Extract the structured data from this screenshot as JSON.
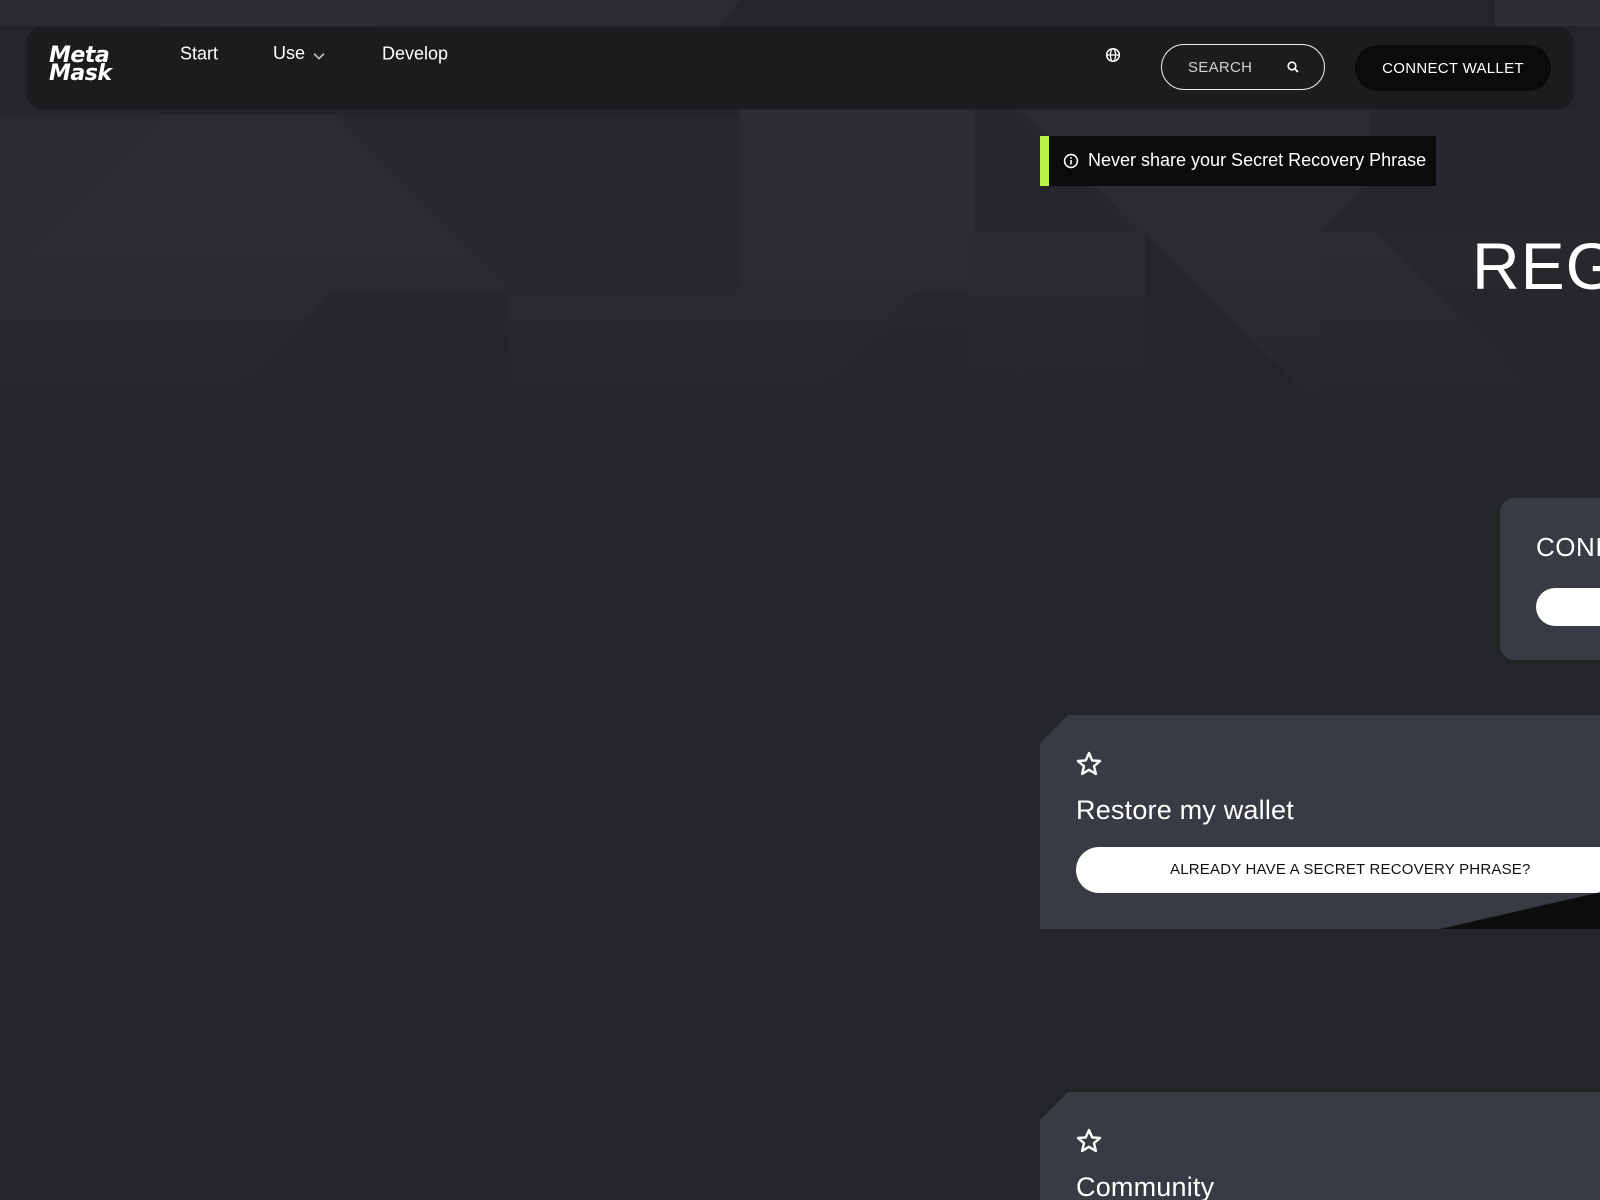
{
  "brand": {
    "logo_line1": "Meta",
    "logo_line2": "Mask"
  },
  "nav": {
    "links": [
      {
        "label": "Start"
      },
      {
        "label": "Use"
      },
      {
        "label": "Develop"
      }
    ],
    "language_icon": "globe-icon",
    "search_placeholder": "SEARCH",
    "search_icon": "search-icon",
    "connect_label": "CONNECT WALLET"
  },
  "warning": {
    "message": "Never share your Secret Recovery Phrase",
    "icon": "info-icon",
    "accent_color": "#baf24a"
  },
  "hero": {
    "title_visible": "REG"
  },
  "connect_card": {
    "title_visible": "CONI"
  },
  "cards": [
    {
      "icon": "star-icon",
      "title": "Restore my wallet",
      "button_label": "ALREADY HAVE A SECRET RECOVERY PHRASE?"
    },
    {
      "icon": "star-icon",
      "title": "Community"
    }
  ],
  "colors": {
    "background": "#242529",
    "navbar": "#1b1c1e",
    "card": "#393b44",
    "accent": "#baf24a"
  }
}
